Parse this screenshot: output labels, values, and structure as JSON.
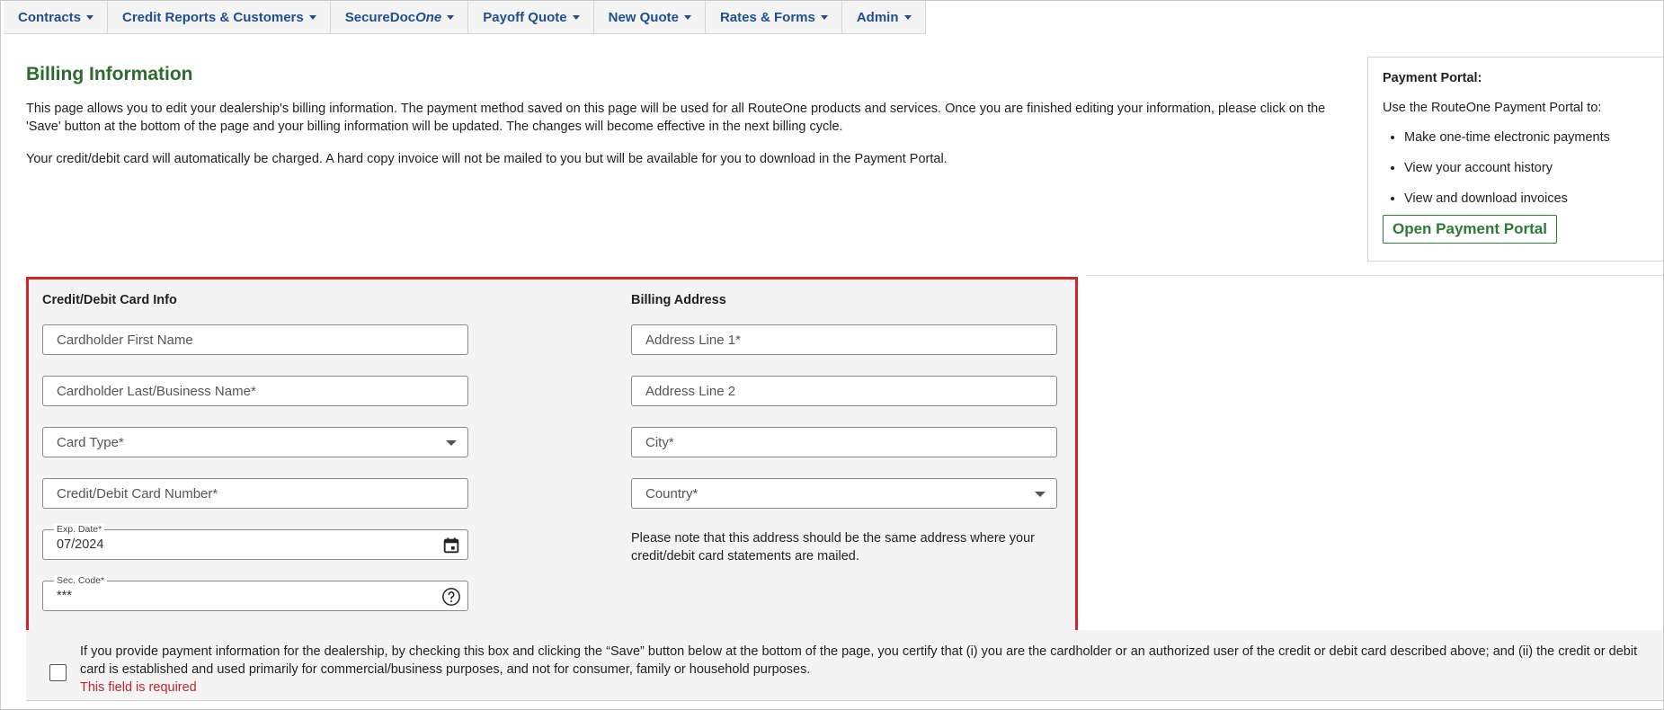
{
  "nav": {
    "items": [
      {
        "label": "Contracts"
      },
      {
        "label": "Credit Reports & Customers"
      },
      {
        "label_main": "SecureDoc",
        "label_italic": "One"
      },
      {
        "label": "Payoff Quote"
      },
      {
        "label": "New Quote"
      },
      {
        "label": "Rates & Forms"
      },
      {
        "label": "Admin"
      }
    ]
  },
  "page": {
    "title": "Billing Information",
    "intro_1": "This page allows you to edit your dealership's billing information. The payment method saved on this page will be used for all RouteOne products and services. Once you are finished editing your information, please click on the 'Save' button at the bottom of the page and your billing information will be updated. The changes will become effective in the next billing cycle.",
    "intro_2": "Your credit/debit card will automatically be charged. A hard copy invoice will not be mailed to you but will be available for you to download in the Payment Portal."
  },
  "portal": {
    "heading": "Payment Portal:",
    "intro": "Use the RouteOne Payment Portal to:",
    "bullets": [
      "Make one-time electronic payments",
      "View your account history",
      "View and download invoices"
    ],
    "button_label": "Open Payment Portal"
  },
  "card_info": {
    "heading": "Credit/Debit Card Info",
    "first_name_placeholder": "Cardholder First Name",
    "last_name_placeholder": "Cardholder Last/Business Name*",
    "card_type_placeholder": "Card Type*",
    "card_number_placeholder": "Credit/Debit Card Number*",
    "exp_date_label": "Exp. Date*",
    "exp_date_value": "07/2024",
    "sec_code_label": "Sec. Code*",
    "sec_code_value": "***"
  },
  "billing_address": {
    "heading": "Billing Address",
    "address1_placeholder": "Address Line 1*",
    "address2_placeholder": "Address Line 2",
    "city_placeholder": "City*",
    "country_placeholder": "Country*",
    "note": "Please note that this address should be the same address where your credit/debit card statements are mailed."
  },
  "certification": {
    "text": "If you provide payment information for the dealership, by checking this box and clicking the “Save” button below at the bottom of the page, you certify that (i) you are the cardholder or an authorized user of the credit or debit card described above; and (ii) the credit or debit card is established and used primarily for commercial/business purposes, and not for consumer, family or household purposes.",
    "error": "This field is required"
  },
  "colors": {
    "nav_text": "#1f4f8f",
    "title_green": "#2c6b2c",
    "button_green": "#2c7a36",
    "highlight_red": "#d3242b",
    "error_red": "#c0262b"
  }
}
